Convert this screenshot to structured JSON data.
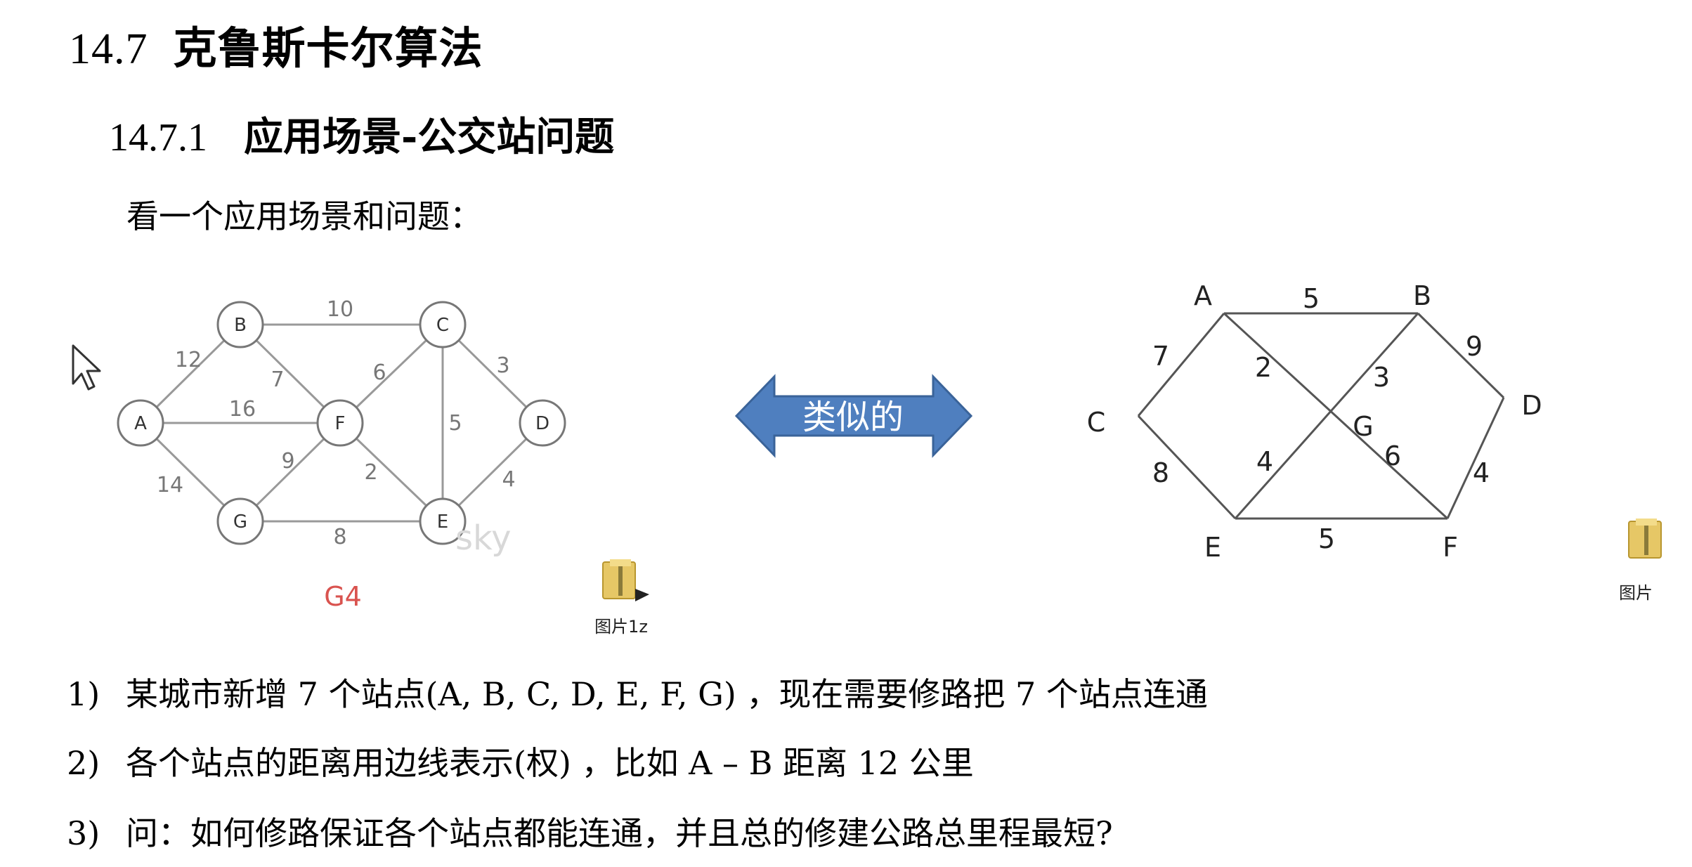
{
  "heading": {
    "number": "14.7",
    "title": "克鲁斯卡尔算法"
  },
  "subheading": {
    "number": "14.7.1",
    "title": "应用场景-公交站问题"
  },
  "intro": "看一个应用场景和问题：",
  "graph_left": {
    "caption": "G4",
    "watermark": "sky",
    "nodes": [
      "A",
      "B",
      "C",
      "D",
      "E",
      "F",
      "G"
    ],
    "edges": [
      {
        "from": "A",
        "to": "B",
        "weight": "12"
      },
      {
        "from": "B",
        "to": "C",
        "weight": "10"
      },
      {
        "from": "A",
        "to": "F",
        "weight": "16"
      },
      {
        "from": "A",
        "to": "G",
        "weight": "14"
      },
      {
        "from": "B",
        "to": "F",
        "weight": "7"
      },
      {
        "from": "F",
        "to": "C",
        "weight": "6"
      },
      {
        "from": "C",
        "to": "D",
        "weight": "3"
      },
      {
        "from": "C",
        "to": "E",
        "weight": "5"
      },
      {
        "from": "F",
        "to": "G",
        "weight": "9"
      },
      {
        "from": "F",
        "to": "E",
        "weight": "2"
      },
      {
        "from": "G",
        "to": "E",
        "weight": "8"
      },
      {
        "from": "E",
        "to": "D",
        "weight": "4"
      }
    ]
  },
  "arrow_label": "类似的",
  "graph_right": {
    "nodes": [
      "A",
      "B",
      "C",
      "D",
      "E",
      "F",
      "G"
    ],
    "edges": [
      {
        "from": "A",
        "to": "B",
        "weight": "5"
      },
      {
        "from": "A",
        "to": "C",
        "weight": "7"
      },
      {
        "from": "A",
        "to": "F",
        "weight": "2"
      },
      {
        "from": "B",
        "to": "E",
        "weight": "3"
      },
      {
        "from": "B",
        "to": "D",
        "weight": "9"
      },
      {
        "from": "C",
        "to": "E",
        "weight": "8"
      },
      {
        "from": "E",
        "to": "F",
        "weight": "5"
      },
      {
        "from": "D",
        "to": "F",
        "weight": "4"
      }
    ],
    "extra_labels": [
      "4",
      "6"
    ]
  },
  "file_icons": [
    {
      "name": "folder-zip-icon",
      "label": "图片1z"
    },
    {
      "name": "folder-zip-icon",
      "label": "图片"
    }
  ],
  "items": [
    {
      "marker": "1)",
      "text": "某城市新增 7 个站点(A, B, C, D, E, F, G) ，现在需要修路把 7 个站点连通"
    },
    {
      "marker": "2)",
      "text": "各个站点的距离用边线表示(权) ，比如  A  –  B  距离  12 公里"
    },
    {
      "marker": "3)",
      "text": "问：如何修路保证各个站点都能连通，并且总的修建公路总里程最短?"
    }
  ],
  "colors": {
    "caption": "#d9534f",
    "arrow": "#4f7fbf",
    "edge": "#888888"
  }
}
